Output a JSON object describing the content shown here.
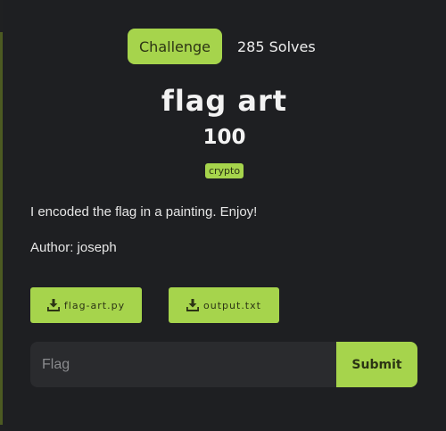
{
  "header": {
    "tab_label": "Challenge",
    "solves_text": "285 Solves"
  },
  "challenge": {
    "title": "flag art",
    "points": "100",
    "category": "crypto",
    "description": "I encoded the flag in a painting. Enjoy!",
    "author": "Author: joseph"
  },
  "files": [
    {
      "label": "flag-art.py",
      "icon": "download-icon"
    },
    {
      "label": "output.txt",
      "icon": "download-icon"
    }
  ],
  "flag_form": {
    "value": "",
    "placeholder": "Flag",
    "submit_label": "Submit"
  },
  "colors": {
    "accent": "#a6d44c",
    "background": "#1e1f22",
    "input_bg": "#2a2b2e",
    "text": "#f2f2f2"
  }
}
